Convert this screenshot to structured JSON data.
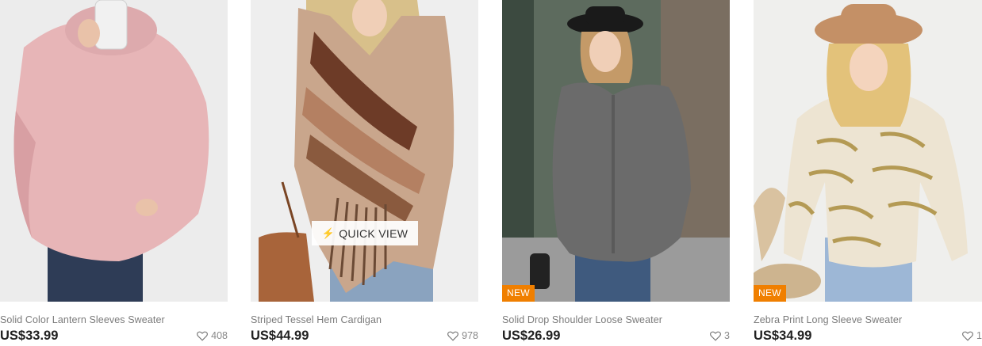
{
  "products": [
    {
      "name": "Solid Color Lantern Sleeves Sweater",
      "price": "US$33.99",
      "likes": "408",
      "badge": null,
      "sweater_color": "#e7b5b7"
    },
    {
      "name": "Striped Tessel Hem Cardigan",
      "price": "US$44.99",
      "likes": "978",
      "badge": null,
      "sweater_color": "#c9a68c"
    },
    {
      "name": "Solid Drop Shoulder Loose Sweater",
      "price": "US$26.99",
      "likes": "3",
      "badge": "NEW",
      "sweater_color": "#6b6b6b"
    },
    {
      "name": "Zebra Print Long Sleeve Sweater",
      "price": "US$34.99",
      "likes": "1",
      "badge": "NEW",
      "sweater_color": "#ede4d2"
    }
  ],
  "quick_view": {
    "label": "QUICK VIEW",
    "icon": "lightning-icon"
  },
  "colors": {
    "badge": "#f07f00",
    "price": "#222222",
    "name": "#7a7a7a"
  }
}
